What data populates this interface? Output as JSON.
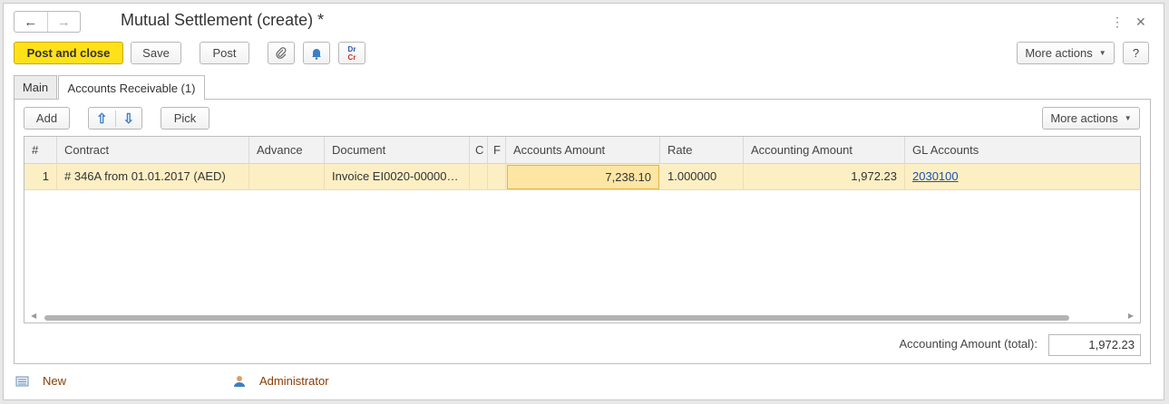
{
  "window": {
    "title": "Mutual Settlement (create) *",
    "back_icon": "←",
    "forward_icon": "→",
    "menu_icon": "⋮",
    "close_icon": "✕"
  },
  "toolbar": {
    "post_and_close": "Post and close",
    "save": "Save",
    "post": "Post",
    "attach_icon": "⌀",
    "notify_icon": "🔔",
    "drcr_top": "Dr",
    "drcr_bottom": "Cr",
    "more_actions": "More actions",
    "help": "?"
  },
  "tabs": [
    {
      "label": "Main"
    },
    {
      "label": "Accounts Receivable (1)"
    }
  ],
  "table_toolbar": {
    "add": "Add",
    "up_icon": "⇧",
    "down_icon": "⇩",
    "pick": "Pick",
    "more_actions": "More actions"
  },
  "table": {
    "columns": [
      "#",
      "Contract",
      "Advance",
      "Document",
      "C",
      "F",
      "Accounts Amount",
      "Rate",
      "Accounting Amount",
      "GL Accounts"
    ],
    "rows": [
      {
        "num": "1",
        "contract": "# 346A from 01.01.2017 (AED)",
        "advance": "",
        "document": "Invoice EI0020-000000...",
        "c": "",
        "f": "",
        "accounts_amount": "7,238.10",
        "rate": "1.000000",
        "accounting_amount": "1,972.23",
        "gl_accounts": "2030100"
      }
    ]
  },
  "totals": {
    "label": "Accounting Amount (total):",
    "value": "1,972.23"
  },
  "status": {
    "state": "New",
    "user": "Administrator"
  },
  "colors": {
    "primary_button": "#ffe11a",
    "row_highlight": "#fcefc4",
    "link": "#1f4fb0",
    "status_text": "#8b3a00"
  }
}
